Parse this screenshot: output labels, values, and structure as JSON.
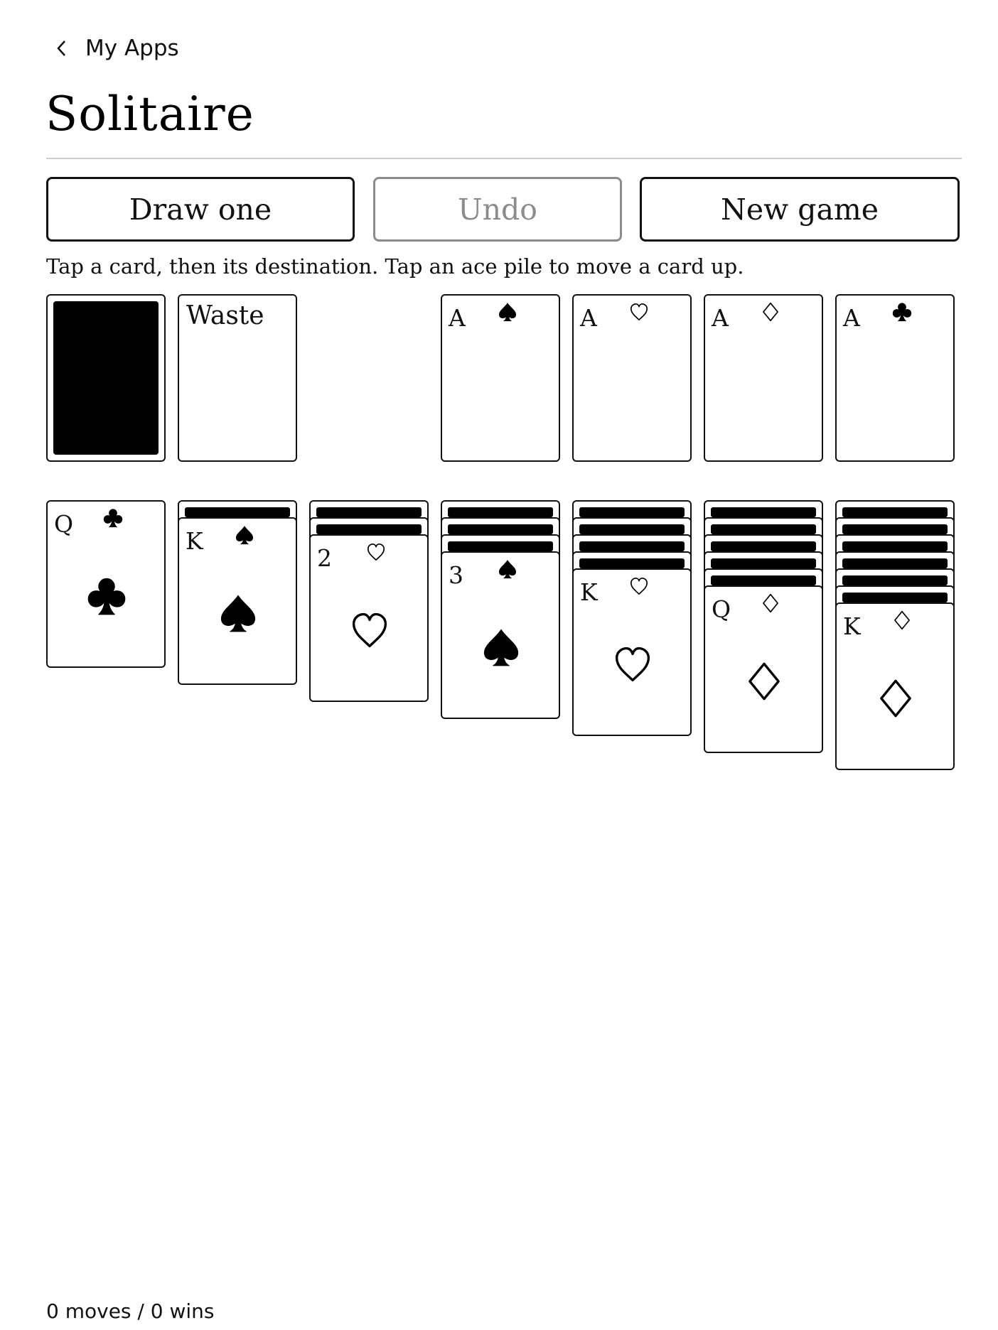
{
  "nav": {
    "back_label": "My Apps",
    "back_icon": "chevron-left-icon"
  },
  "page": {
    "title": "Solitaire"
  },
  "toolbar": {
    "draw_label": "Draw one",
    "undo_label": "Undo",
    "undo_enabled": false,
    "new_game_label": "New game"
  },
  "instructions": "Tap a card, then its destination. Tap an ace pile to move a card up.",
  "stock": {
    "face_down": true
  },
  "waste": {
    "label": "Waste"
  },
  "foundations": [
    {
      "rank": "A",
      "suit": "spade",
      "filled": true
    },
    {
      "rank": "A",
      "suit": "heart",
      "filled": false
    },
    {
      "rank": "A",
      "suit": "diamond",
      "filled": false
    },
    {
      "rank": "A",
      "suit": "club",
      "filled": true
    }
  ],
  "tableau": [
    {
      "face_down": 0,
      "top": {
        "rank": "Q",
        "suit": "club",
        "filled": true
      }
    },
    {
      "face_down": 1,
      "top": {
        "rank": "K",
        "suit": "spade",
        "filled": true
      }
    },
    {
      "face_down": 2,
      "top": {
        "rank": "2",
        "suit": "heart",
        "filled": false
      }
    },
    {
      "face_down": 3,
      "top": {
        "rank": "3",
        "suit": "spade",
        "filled": true
      }
    },
    {
      "face_down": 4,
      "top": {
        "rank": "K",
        "suit": "heart",
        "filled": false
      }
    },
    {
      "face_down": 5,
      "top": {
        "rank": "Q",
        "suit": "diamond",
        "filled": false
      }
    },
    {
      "face_down": 6,
      "top": {
        "rank": "K",
        "suit": "diamond",
        "filled": false
      }
    }
  ],
  "footer": {
    "stats": "0 moves / 0 wins"
  },
  "colors": {
    "ink": "#000000",
    "disabled": "#8c8c8c",
    "rule": "#cccccc",
    "background": "#ffffff"
  }
}
